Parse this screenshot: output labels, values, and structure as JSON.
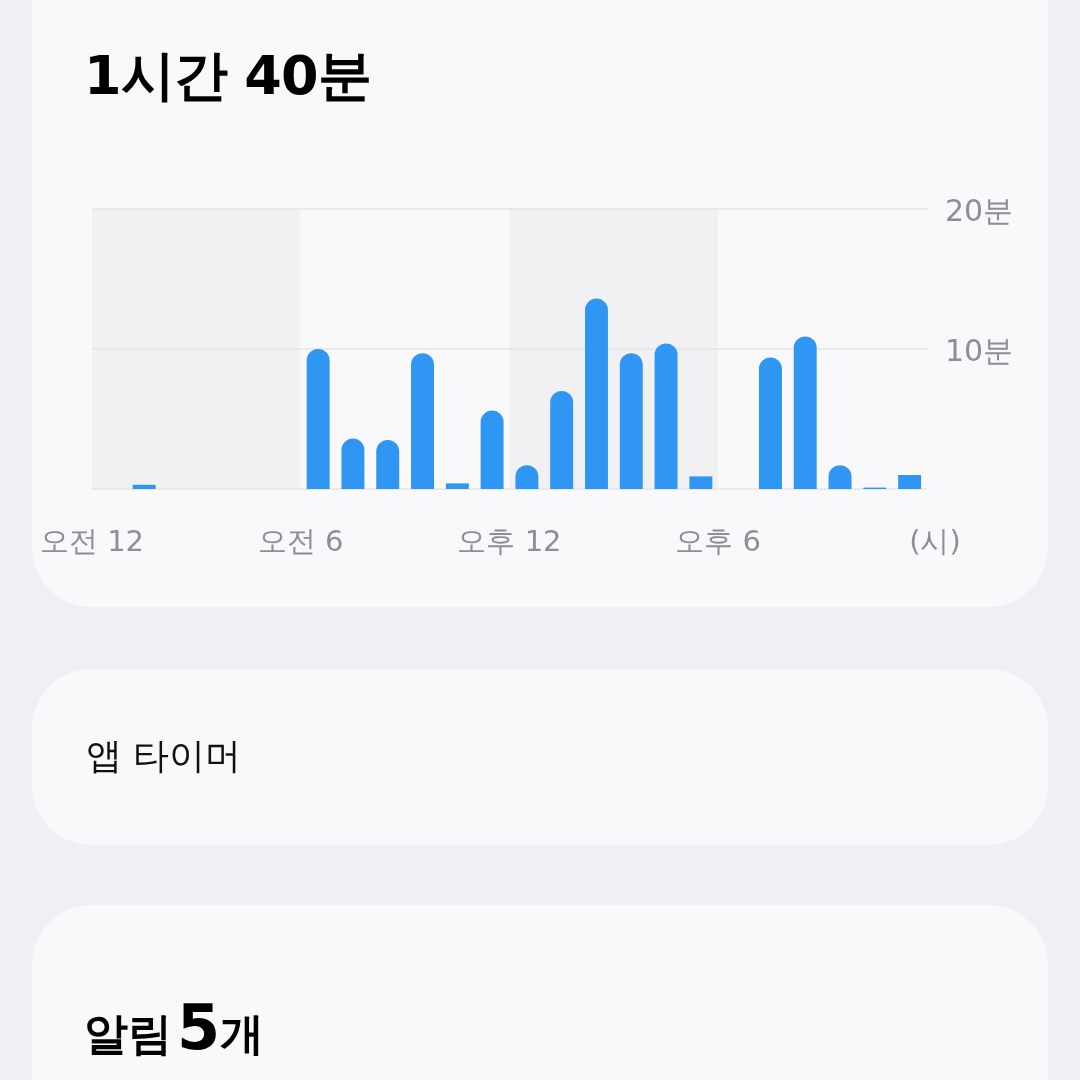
{
  "screen_time": {
    "total": "1시간 40분",
    "chart_data": {
      "type": "bar",
      "categories": [
        "오전 12",
        null,
        null,
        null,
        null,
        null,
        "오전 6",
        null,
        null,
        null,
        null,
        null,
        "오후 12",
        null,
        null,
        null,
        null,
        null,
        "오후 6",
        null,
        null,
        null,
        null,
        null
      ],
      "series": [
        {
          "color": "#2f96f3",
          "values": [
            0,
            0.3,
            0,
            0,
            0,
            0,
            10,
            3.6,
            3.5,
            9.7,
            0.4,
            5.6,
            1.7,
            7,
            13.6,
            9.7,
            10.4,
            0.9,
            0,
            9.4,
            10.9,
            1.7,
            0.1,
            1
          ]
        }
      ],
      "ylim": [
        0,
        20
      ],
      "xlabel": "(시)",
      "yticks": [
        {
          "value": 10,
          "label": "10분"
        },
        {
          "value": 20,
          "label": "20분"
        }
      ]
    }
  },
  "app_timer": {
    "label": "앱 타이머"
  },
  "notifications": {
    "label": "알림",
    "count": "5",
    "unit": "개"
  }
}
